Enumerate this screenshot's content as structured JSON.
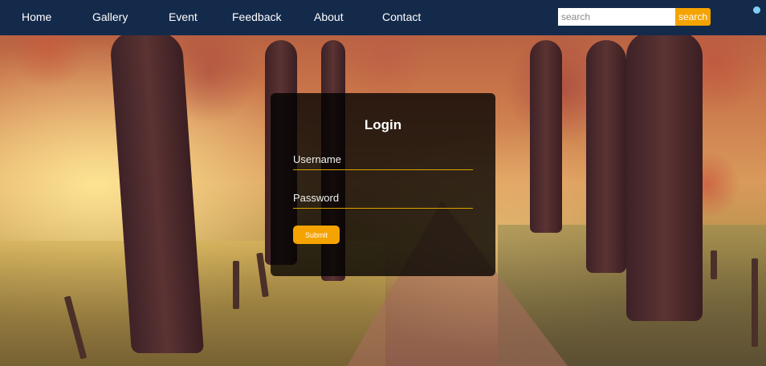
{
  "nav": {
    "items": [
      {
        "label": "Home"
      },
      {
        "label": "Gallery"
      },
      {
        "label": "Event"
      },
      {
        "label": "Feedback"
      },
      {
        "label": "About"
      },
      {
        "label": "Contact"
      }
    ],
    "search_placeholder": "search",
    "search_button": "search"
  },
  "login": {
    "title": "Login",
    "username_placeholder": "Username",
    "password_placeholder": "Password",
    "submit_label": "Submit"
  },
  "colors": {
    "navbar": "#142a4b",
    "accent": "#f5a300",
    "card": "rgba(0,0,0,0.78)"
  }
}
